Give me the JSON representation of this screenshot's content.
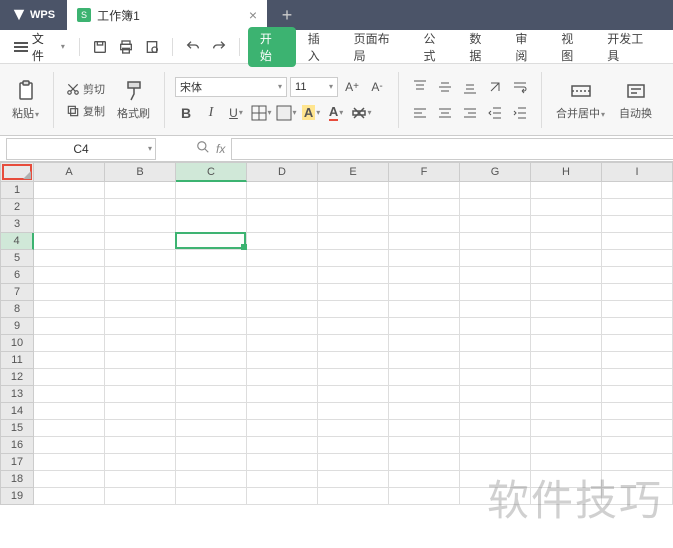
{
  "titlebar": {
    "app": "WPS",
    "tab_label": "工作簿1",
    "close": "×",
    "new": "+"
  },
  "menubar": {
    "file": "文件",
    "items": [
      "开始",
      "插入",
      "页面布局",
      "公式",
      "数据",
      "审阅",
      "视图",
      "开发工具"
    ]
  },
  "ribbon": {
    "paste": "粘贴",
    "cut": "剪切",
    "copy": "复制",
    "format_painter": "格式刷",
    "font_name": "宋体",
    "font_size": "11",
    "merge_center": "合并居中",
    "auto_wrap": "自动换"
  },
  "namebox": {
    "value": "C4"
  },
  "formula": {
    "fx": "fx",
    "value": ""
  },
  "grid": {
    "cols": [
      "A",
      "B",
      "C",
      "D",
      "E",
      "F",
      "G",
      "H",
      "I"
    ],
    "rows": [
      "1",
      "2",
      "3",
      "4",
      "5",
      "6",
      "7",
      "8",
      "9",
      "10",
      "11",
      "12",
      "13",
      "14",
      "15",
      "16",
      "17",
      "18",
      "19"
    ],
    "selected_col": "C",
    "selected_row": "4"
  },
  "watermark": "软件技巧"
}
